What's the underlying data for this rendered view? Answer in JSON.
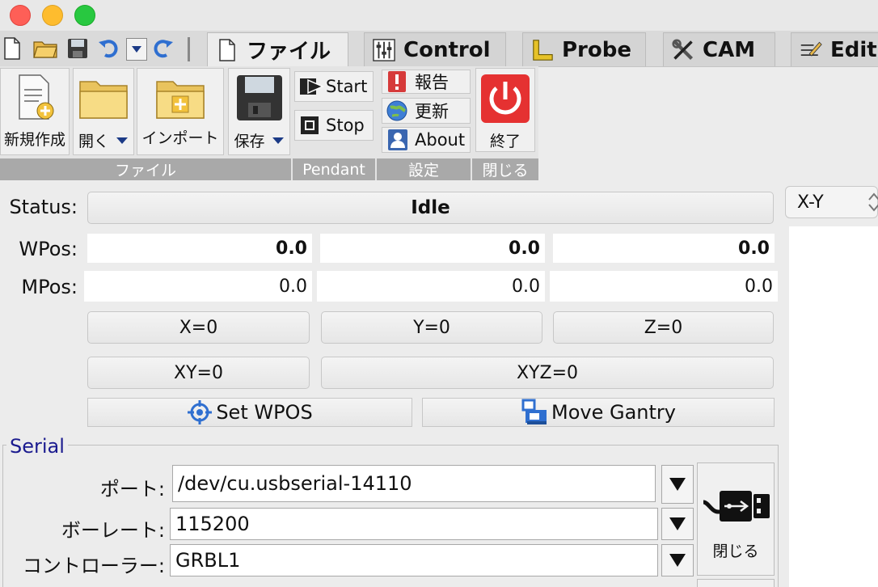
{
  "quick_toolbar": {
    "icons": [
      "new-file-icon",
      "open-folder-icon",
      "save-icon",
      "undo-icon",
      "dropdown-icon",
      "redo-icon"
    ]
  },
  "tabs": [
    {
      "label": "ファイル",
      "icon": "file-icon"
    },
    {
      "label": "Control",
      "icon": "sliders-icon"
    },
    {
      "label": "Probe",
      "icon": "ruler-icon"
    },
    {
      "label": "CAM",
      "icon": "tools-icon"
    },
    {
      "label": "Edit",
      "icon": "pencil-icon"
    }
  ],
  "ribbon": {
    "file_group": {
      "new_label": "新規作成",
      "open_label": "開く",
      "import_label": "インポート",
      "save_label": "保存",
      "group_label": "ファイル"
    },
    "pendant_group": {
      "start_label": "Start",
      "stop_label": "Stop",
      "group_label": "Pendant"
    },
    "settings_group": {
      "report_label": "報告",
      "update_label": "更新",
      "about_label": "About",
      "group_label": "設定"
    },
    "close_group": {
      "quit_label": "終了",
      "group_label": "閉じる"
    }
  },
  "status": {
    "label": "Status:",
    "value": "Idle"
  },
  "wpos": {
    "label": "WPos:",
    "values": [
      "0.0",
      "0.0",
      "0.0"
    ]
  },
  "mpos": {
    "label": "MPos:",
    "values": [
      "0.0",
      "0.0",
      "0.0"
    ]
  },
  "zero_buttons": {
    "x": "X=0",
    "y": "Y=0",
    "z": "Z=0",
    "xy": "XY=0",
    "xyz": "XYZ=0"
  },
  "actions": {
    "set_wpos": "Set WPOS",
    "move_gantry": "Move Gantry"
  },
  "serial": {
    "legend": "Serial",
    "port_label": "ポート:",
    "port_value": "/dev/cu.usbserial-14110",
    "baud_label": "ボーレート:",
    "baud_value": "115200",
    "controller_label": "コントローラー:",
    "controller_value": "GRBL1",
    "close_label": "閉じる"
  },
  "view_select": {
    "value": "X-Y"
  },
  "colors": {
    "accent_blue": "#2f6fd0",
    "close_red": "#e53131",
    "group_bar": "#a9a9a9"
  }
}
